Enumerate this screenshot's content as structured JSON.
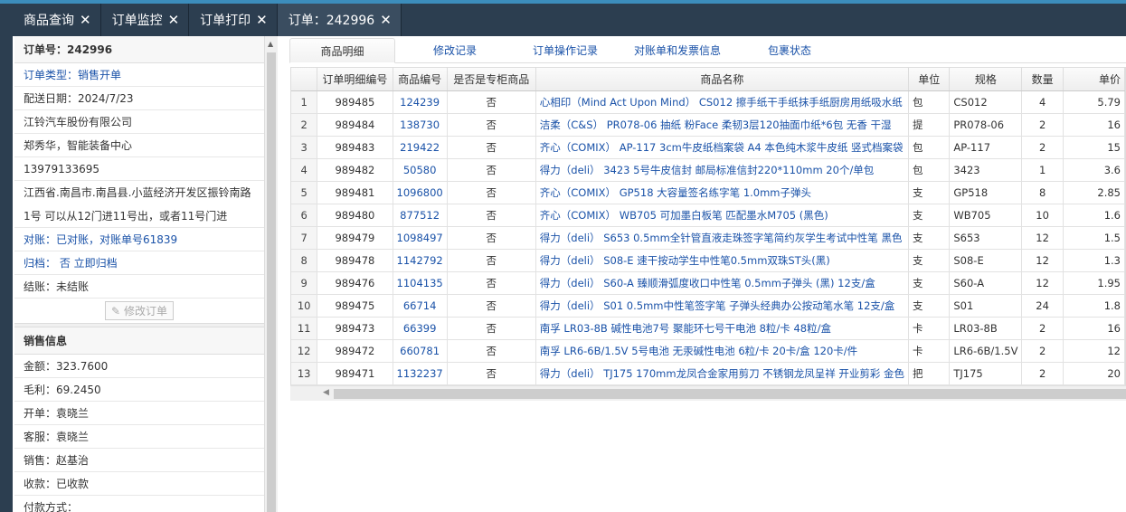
{
  "tabs": [
    {
      "label": "商品查询"
    },
    {
      "label": "订单监控"
    },
    {
      "label": "订单打印"
    },
    {
      "label": "订单：242996"
    }
  ],
  "order": {
    "number_label": "订单号：242996",
    "type": "订单类型：销售开单",
    "delivery_date": "配送日期：2024/7/23",
    "company": "江铃汽车股份有限公司",
    "contact": "郑秀华，智能装备中心",
    "phone": "13979133695",
    "address_line1": "江西省.南昌市.南昌县.小蓝经济开发区振铃南路",
    "address_line2": "1号 可以从12门进11号出，或者11号门进",
    "reconcile": "对账：已对账，对账单号61839",
    "archive": "归档： 否 立即归档",
    "settle": "结账：未结账",
    "edit_button": "修改订单"
  },
  "sales": {
    "title": "销售信息",
    "amount": "金额：323.7600",
    "profit": "毛利：69.2450",
    "issuer": "开单：袁晓兰",
    "service": "客服：袁晓兰",
    "seller": "销售：赵基治",
    "collection": "收款：已收款",
    "payment": "付款方式："
  },
  "subtabs": [
    {
      "label": "商品明细"
    },
    {
      "label": "修改记录"
    },
    {
      "label": "订单操作记录"
    },
    {
      "label": "对账单和发票信息"
    },
    {
      "label": "包裹状态"
    }
  ],
  "table": {
    "headers": [
      "",
      "订单明细编号",
      "商品编号",
      "是否是专柜商品",
      "商品名称",
      "单位",
      "规格",
      "数量",
      "单价"
    ],
    "rows": [
      [
        "1",
        "989485",
        "124239",
        "否",
        "心相印（Mind Act Upon Mind） CS012 擦手纸干手纸抹手纸厨房用纸吸水纸",
        "包",
        "CS012",
        "4",
        "5.79"
      ],
      [
        "2",
        "989484",
        "138730",
        "否",
        "洁柔（C&S） PR078-06 抽纸 粉Face 柔韧3层120抽面巾纸*6包 无香 干湿",
        "提",
        "PR078-06",
        "2",
        "16"
      ],
      [
        "3",
        "989483",
        "219422",
        "否",
        "齐心（COMIX） AP-117 3cm牛皮纸档案袋 A4 本色纯木浆牛皮纸 竖式档案袋",
        "包",
        "AP-117",
        "2",
        "15"
      ],
      [
        "4",
        "989482",
        "50580",
        "否",
        "得力（deli） 3423 5号牛皮信封 邮局标准信封220*110mm 20个/单包",
        "包",
        "3423",
        "1",
        "3.6"
      ],
      [
        "5",
        "989481",
        "1096800",
        "否",
        "齐心（COMIX） GP518 大容量签名练字笔 1.0mm子弹头",
        "支",
        "GP518",
        "8",
        "2.85"
      ],
      [
        "6",
        "989480",
        "877512",
        "否",
        "齐心（COMIX） WB705 可加墨白板笔 匹配墨水M705 (黑色)",
        "支",
        "WB705",
        "10",
        "1.6"
      ],
      [
        "7",
        "989479",
        "1098497",
        "否",
        "得力（deli） S653 0.5mm全针管直液走珠签字笔简约灰学生考试中性笔 黑色",
        "支",
        "S653",
        "12",
        "1.5"
      ],
      [
        "8",
        "989478",
        "1142792",
        "否",
        "得力（deli） S08-E 速干按动学生中性笔0.5mm双珠ST头(黑)",
        "支",
        "S08-E",
        "12",
        "1.3"
      ],
      [
        "9",
        "989476",
        "1104135",
        "否",
        "得力（deli） S60-A 臻顺滑弧度收口中性笔 0.5mm子弹头 (黑) 12支/盒",
        "支",
        "S60-A",
        "12",
        "1.95"
      ],
      [
        "10",
        "989475",
        "66714",
        "否",
        "得力（deli） S01 0.5mm中性笔签字笔 子弹头经典办公按动笔水笔 12支/盒",
        "支",
        "S01",
        "24",
        "1.8"
      ],
      [
        "11",
        "989473",
        "66399",
        "否",
        "南孚 LR03-8B 碱性电池7号 聚能环七号干电池 8粒/卡 48粒/盒",
        "卡",
        "LR03-8B",
        "2",
        "16"
      ],
      [
        "12",
        "989472",
        "660781",
        "否",
        "南孚 LR6-6B/1.5V 5号电池 无汞碱性电池 6粒/卡 20卡/盒 120卡/件",
        "卡",
        "LR6-6B/1.5V",
        "2",
        "12"
      ],
      [
        "13",
        "989471",
        "1132237",
        "否",
        "得力（deli） TJ175 170mm龙凤合金家用剪刀 不锈钢龙凤呈祥 开业剪彩 金色",
        "把",
        "TJ175",
        "2",
        "20"
      ]
    ]
  }
}
